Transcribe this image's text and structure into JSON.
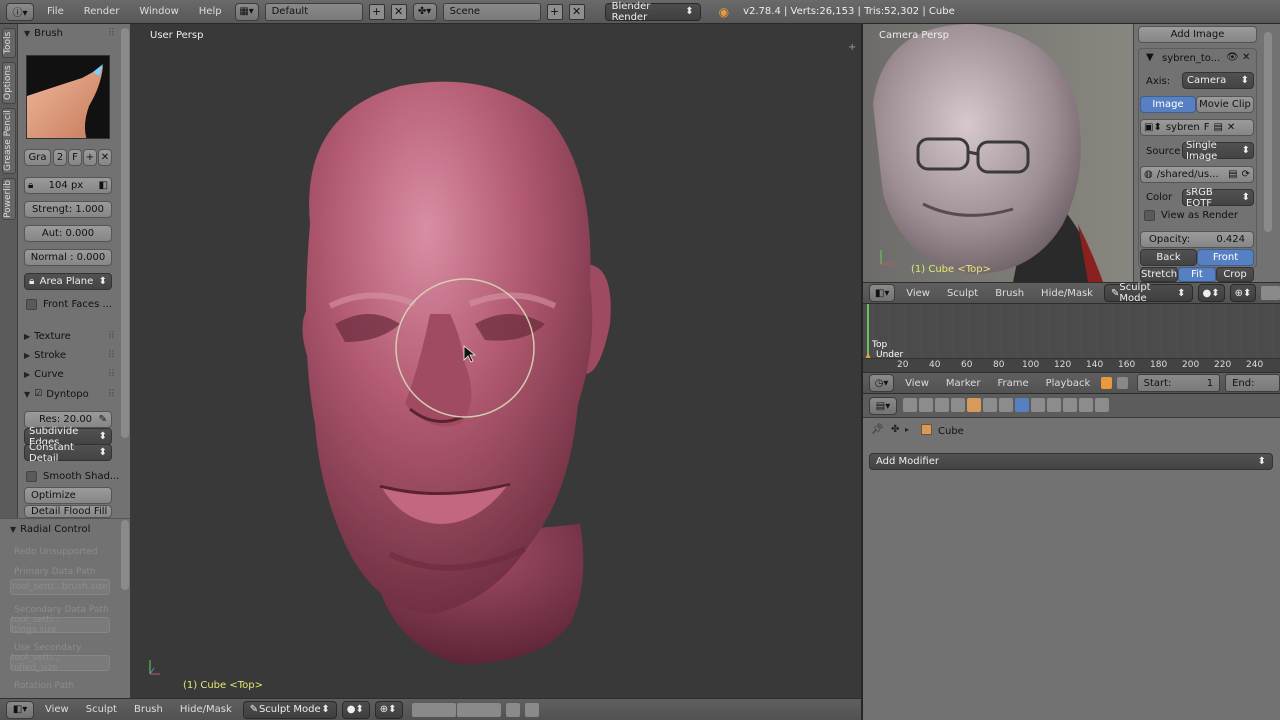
{
  "header": {
    "menus": [
      "File",
      "Render",
      "Window",
      "Help"
    ],
    "screen_layout": "Default",
    "scene": "Scene",
    "render_engine": "Blender Render",
    "stats": "v2.78.4 | Verts:26,153 | Tris:52,302 | Cube"
  },
  "tool_tabs": [
    "Tools",
    "Options",
    "Grease Pencil",
    "Powerlib"
  ],
  "shelf": {
    "brush_panel": "Brush",
    "brush_name": "Gra",
    "brush_users": "2",
    "fake_user": "F",
    "radius": "104 px",
    "strength": "Strengt: 1.000",
    "autosmooth": "Aut: 0.000",
    "normal": "Normal : 0.000",
    "sculpt_plane": "Area Plane",
    "front_faces": "Front Faces ...",
    "texture_panel": "Texture",
    "stroke_panel": "Stroke",
    "curve_panel": "Curve",
    "dyntopo_panel": "Dyntopo",
    "resolution": "Res: 20.00",
    "detail_method": "Subdivide Edges",
    "detail_type": "Constant Detail",
    "smooth_shading": "Smooth Shad...",
    "optimize": "Optimize",
    "detail_flood_fill": "Detail Flood Fill"
  },
  "redo_panel": {
    "title": "Radial Control",
    "unsupported": "Redo Unsupported",
    "primary_label": "Primary Data Path",
    "primary_value": "tool_setti...brush.size",
    "secondary_label": "Secondary Data Path",
    "secondary_value": "tool_setti... ttings.size",
    "use_secondary_label": "Use Secondary",
    "use_secondary_value": "tool_setti... nified_size",
    "rotation_path_label": "Rotation Path"
  },
  "viewport": {
    "view_label": "User Persp",
    "object_label": "(1) Cube <Top>"
  },
  "bottom_header": {
    "menus": [
      "View",
      "Sculpt",
      "Brush",
      "Hide/Mask"
    ],
    "mode": "Sculpt Mode"
  },
  "camera_view": {
    "view_label": "Camera Persp",
    "object_label": "(1) Cube <Top>"
  },
  "background_images": {
    "add_image": "Add Image",
    "image_name": "sybren_to...",
    "axis_label": "Axis:",
    "axis_value": "Camera",
    "tab_image": "Image",
    "tab_movie_clip": "Movie Clip",
    "datablock": "sybren",
    "datablock_fake": "F",
    "source_label": "Source",
    "source_value": "Single Image",
    "filepath": "/shared/us...",
    "color_label": "Color",
    "color_value": "sRGB EOTF",
    "view_as_render": "View as Render",
    "opacity": "Opacity:",
    "opacity_value": "0.424",
    "back": "Back",
    "front": "Front",
    "stretch": "Stretch",
    "fit": "Fit",
    "crop": "Crop"
  },
  "camera_header": {
    "menus": [
      "View",
      "Sculpt",
      "Brush",
      "Hide/Mask"
    ],
    "mode": "Sculpt Mode"
  },
  "timeline": {
    "ticks": [
      "20",
      "40",
      "60",
      "80",
      "100",
      "120",
      "140",
      "160",
      "180",
      "200",
      "220",
      "240"
    ],
    "marker_top": "Top",
    "marker_under": "Under",
    "menus": [
      "View",
      "Marker",
      "Frame",
      "Playback"
    ],
    "start_label": "Start:",
    "start_value": "1",
    "end_label": "End:"
  },
  "modifiers": {
    "object_name": "Cube",
    "add_modifier": "Add Modifier"
  },
  "colors": {
    "accent_blue": "#5680c2",
    "mesh_pink": "#b2566f",
    "object_label_yellow": "#e6e675"
  }
}
